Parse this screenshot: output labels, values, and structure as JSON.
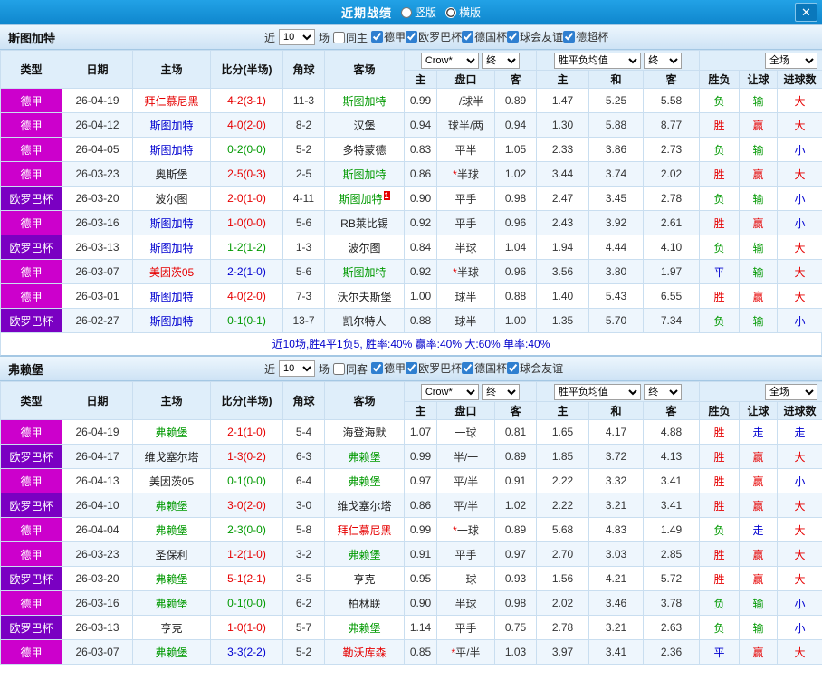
{
  "colors": {
    "titlebar_bg": "#1596DE",
    "accent_red": "#E60000",
    "accent_green": "#009900",
    "accent_blue": "#0000D0",
    "league_colors": {
      "德甲": "#CC00CC",
      "欧罗巴杯": "#7A00C2"
    }
  },
  "titlebar": {
    "title": "近期战绩",
    "layout_options": [
      {
        "label": "竖版",
        "selected": false
      },
      {
        "label": "横版",
        "selected": true
      }
    ],
    "close_label": "✕"
  },
  "table_header": {
    "type": "类型",
    "date": "日期",
    "home": "主场",
    "score": "比分(半场)",
    "corner": "角球",
    "away": "客场",
    "bookmaker_select": "Crow*",
    "final_select_1": "终",
    "avg_select": "胜平负均值",
    "final_select_2": "终",
    "scope_select": "全场",
    "sub_home": "主",
    "sub_line": "盘口",
    "sub_away": "客",
    "sub_home2": "主",
    "sub_draw": "和",
    "sub_away2": "客",
    "wdl": "胜负",
    "handicap_result": "让球",
    "goals": "进球数"
  },
  "sections": [
    {
      "team": "斯图加特",
      "near_label": "近",
      "match_count": "10",
      "games_label": "场",
      "venue_filter": {
        "label": "同主",
        "checked": false
      },
      "filters": [
        {
          "label": "德甲",
          "checked": true
        },
        {
          "label": "欧罗巴杯",
          "checked": true
        },
        {
          "label": "德国杯",
          "checked": true
        },
        {
          "label": "球会友谊",
          "checked": true
        },
        {
          "label": "德超杯",
          "checked": true
        }
      ],
      "rows": [
        {
          "league": "德甲",
          "date": "26-04-19",
          "home": "拜仁慕尼黑",
          "home_color": "red",
          "score": "4-2(3-1)",
          "score_color": "red",
          "corners": "11-3",
          "away": "斯图加特",
          "away_color": "green",
          "handicap_home": "0.99",
          "handicap": "一/球半",
          "handicap_away": "0.89",
          "avg_home": "1.47",
          "avg_draw": "5.25",
          "avg_away": "5.58",
          "wdl": "负",
          "wdl_color": "green",
          "let": "输",
          "let_color": "green",
          "goal": "大",
          "goal_color": "red"
        },
        {
          "league": "德甲",
          "date": "26-04-12",
          "home": "斯图加特",
          "home_color": "blue",
          "score": "4-0(2-0)",
          "score_color": "red",
          "corners": "8-2",
          "away": "汉堡",
          "away_color": "black",
          "handicap_home": "0.94",
          "handicap": "球半/两",
          "handicap_away": "0.94",
          "avg_home": "1.30",
          "avg_draw": "5.88",
          "avg_away": "8.77",
          "wdl": "胜",
          "wdl_color": "red",
          "let": "赢",
          "let_color": "red",
          "goal": "大",
          "goal_color": "red"
        },
        {
          "league": "德甲",
          "date": "26-04-05",
          "home": "斯图加特",
          "home_color": "blue",
          "score": "0-2(0-0)",
          "score_color": "green",
          "corners": "5-2",
          "away": "多特蒙德",
          "away_color": "black",
          "handicap_home": "0.83",
          "handicap": "平半",
          "handicap_away": "1.05",
          "avg_home": "2.33",
          "avg_draw": "3.86",
          "avg_away": "2.73",
          "wdl": "负",
          "wdl_color": "green",
          "let": "输",
          "let_color": "green",
          "goal": "小",
          "goal_color": "blue"
        },
        {
          "league": "德甲",
          "date": "26-03-23",
          "home": "奥斯堡",
          "home_color": "black",
          "score": "2-5(0-3)",
          "score_color": "red",
          "corners": "2-5",
          "away": "斯图加特",
          "away_color": "green",
          "handicap_home": "0.86",
          "handicap": "*半球",
          "handicap_away": "1.02",
          "avg_home": "3.44",
          "avg_draw": "3.74",
          "avg_away": "2.02",
          "wdl": "胜",
          "wdl_color": "red",
          "let": "赢",
          "let_color": "red",
          "goal": "大",
          "goal_color": "red"
        },
        {
          "league": "欧罗巴杯",
          "date": "26-03-20",
          "home": "波尔图",
          "home_color": "black",
          "score": "2-0(1-0)",
          "score_color": "red",
          "corners": "4-11",
          "away": "斯图加特",
          "away_color": "green",
          "away_sup": "1",
          "handicap_home": "0.90",
          "handicap": "平手",
          "handicap_away": "0.98",
          "avg_home": "2.47",
          "avg_draw": "3.45",
          "avg_away": "2.78",
          "wdl": "负",
          "wdl_color": "green",
          "let": "输",
          "let_color": "green",
          "goal": "小",
          "goal_color": "blue"
        },
        {
          "league": "德甲",
          "date": "26-03-16",
          "home": "斯图加特",
          "home_color": "blue",
          "score": "1-0(0-0)",
          "score_color": "red",
          "corners": "5-6",
          "away": "RB莱比锡",
          "away_color": "black",
          "handicap_home": "0.92",
          "handicap": "平手",
          "handicap_away": "0.96",
          "avg_home": "2.43",
          "avg_draw": "3.92",
          "avg_away": "2.61",
          "wdl": "胜",
          "wdl_color": "red",
          "let": "赢",
          "let_color": "red",
          "goal": "小",
          "goal_color": "blue"
        },
        {
          "league": "欧罗巴杯",
          "date": "26-03-13",
          "home": "斯图加特",
          "home_color": "blue",
          "score": "1-2(1-2)",
          "score_color": "green",
          "corners": "1-3",
          "away": "波尔图",
          "away_color": "black",
          "handicap_home": "0.84",
          "handicap": "半球",
          "handicap_away": "1.04",
          "avg_home": "1.94",
          "avg_draw": "4.44",
          "avg_away": "4.10",
          "wdl": "负",
          "wdl_color": "green",
          "let": "输",
          "let_color": "green",
          "goal": "大",
          "goal_color": "red"
        },
        {
          "league": "德甲",
          "date": "26-03-07",
          "home": "美因茨05",
          "home_color": "red",
          "score": "2-2(1-0)",
          "score_color": "blue",
          "corners": "5-6",
          "away": "斯图加特",
          "away_color": "green",
          "handicap_home": "0.92",
          "handicap": "*半球",
          "handicap_away": "0.96",
          "avg_home": "3.56",
          "avg_draw": "3.80",
          "avg_away": "1.97",
          "wdl": "平",
          "wdl_color": "blue",
          "let": "输",
          "let_color": "green",
          "goal": "大",
          "goal_color": "red"
        },
        {
          "league": "德甲",
          "date": "26-03-01",
          "home": "斯图加特",
          "home_color": "blue",
          "score": "4-0(2-0)",
          "score_color": "red",
          "corners": "7-3",
          "away": "沃尔夫斯堡",
          "away_color": "black",
          "handicap_home": "1.00",
          "handicap": "球半",
          "handicap_away": "0.88",
          "avg_home": "1.40",
          "avg_draw": "5.43",
          "avg_away": "6.55",
          "wdl": "胜",
          "wdl_color": "red",
          "let": "赢",
          "let_color": "red",
          "goal": "大",
          "goal_color": "red"
        },
        {
          "league": "欧罗巴杯",
          "date": "26-02-27",
          "home": "斯图加特",
          "home_color": "blue",
          "score": "0-1(0-1)",
          "score_color": "green",
          "corners": "13-7",
          "away": "凯尔特人",
          "away_color": "black",
          "handicap_home": "0.88",
          "handicap": "球半",
          "handicap_away": "1.00",
          "avg_home": "1.35",
          "avg_draw": "5.70",
          "avg_away": "7.34",
          "wdl": "负",
          "wdl_color": "green",
          "let": "输",
          "let_color": "green",
          "goal": "小",
          "goal_color": "blue"
        }
      ],
      "summary": "近10场,胜4平1负5, 胜率:40% 赢率:40% 大:60% 单率:40%"
    },
    {
      "team": "弗赖堡",
      "near_label": "近",
      "match_count": "10",
      "games_label": "场",
      "venue_filter": {
        "label": "同客",
        "checked": false
      },
      "filters": [
        {
          "label": "德甲",
          "checked": true
        },
        {
          "label": "欧罗巴杯",
          "checked": true
        },
        {
          "label": "德国杯",
          "checked": true
        },
        {
          "label": "球会友谊",
          "checked": true
        }
      ],
      "rows": [
        {
          "league": "德甲",
          "date": "26-04-19",
          "home": "弗赖堡",
          "home_color": "green",
          "score": "2-1(1-0)",
          "score_color": "red",
          "corners": "5-4",
          "away": "海登海默",
          "away_color": "black",
          "handicap_home": "1.07",
          "handicap": "一球",
          "handicap_away": "0.81",
          "avg_home": "1.65",
          "avg_draw": "4.17",
          "avg_away": "4.88",
          "wdl": "胜",
          "wdl_color": "red",
          "let": "走",
          "let_color": "blue",
          "goal": "走",
          "goal_color": "blue"
        },
        {
          "league": "欧罗巴杯",
          "date": "26-04-17",
          "home": "维戈塞尔塔",
          "home_color": "black",
          "score": "1-3(0-2)",
          "score_color": "red",
          "corners": "6-3",
          "away": "弗赖堡",
          "away_color": "green",
          "handicap_home": "0.99",
          "handicap": "半/一",
          "handicap_away": "0.89",
          "avg_home": "1.85",
          "avg_draw": "3.72",
          "avg_away": "4.13",
          "wdl": "胜",
          "wdl_color": "red",
          "let": "赢",
          "let_color": "red",
          "goal": "大",
          "goal_color": "red"
        },
        {
          "league": "德甲",
          "date": "26-04-13",
          "home": "美因茨05",
          "home_color": "black",
          "score": "0-1(0-0)",
          "score_color": "green",
          "corners": "6-4",
          "away": "弗赖堡",
          "away_color": "green",
          "handicap_home": "0.97",
          "handicap": "平/半",
          "handicap_away": "0.91",
          "avg_home": "2.22",
          "avg_draw": "3.32",
          "avg_away": "3.41",
          "wdl": "胜",
          "wdl_color": "red",
          "let": "赢",
          "let_color": "red",
          "goal": "小",
          "goal_color": "blue"
        },
        {
          "league": "欧罗巴杯",
          "date": "26-04-10",
          "home": "弗赖堡",
          "home_color": "green",
          "score": "3-0(2-0)",
          "score_color": "red",
          "corners": "3-0",
          "away": "维戈塞尔塔",
          "away_color": "black",
          "handicap_home": "0.86",
          "handicap": "平/半",
          "handicap_away": "1.02",
          "avg_home": "2.22",
          "avg_draw": "3.21",
          "avg_away": "3.41",
          "wdl": "胜",
          "wdl_color": "red",
          "let": "赢",
          "let_color": "red",
          "goal": "大",
          "goal_color": "red"
        },
        {
          "league": "德甲",
          "date": "26-04-04",
          "home": "弗赖堡",
          "home_color": "green",
          "score": "2-3(0-0)",
          "score_color": "green",
          "corners": "5-8",
          "away": "拜仁慕尼黑",
          "away_color": "red",
          "handicap_home": "0.99",
          "handicap": "*一球",
          "handicap_away": "0.89",
          "avg_home": "5.68",
          "avg_draw": "4.83",
          "avg_away": "1.49",
          "wdl": "负",
          "wdl_color": "green",
          "let": "走",
          "let_color": "blue",
          "goal": "大",
          "goal_color": "red"
        },
        {
          "league": "德甲",
          "date": "26-03-23",
          "home": "圣保利",
          "home_color": "black",
          "score": "1-2(1-0)",
          "score_color": "red",
          "corners": "3-2",
          "away": "弗赖堡",
          "away_color": "green",
          "handicap_home": "0.91",
          "handicap": "平手",
          "handicap_away": "0.97",
          "avg_home": "2.70",
          "avg_draw": "3.03",
          "avg_away": "2.85",
          "wdl": "胜",
          "wdl_color": "red",
          "let": "赢",
          "let_color": "red",
          "goal": "大",
          "goal_color": "red"
        },
        {
          "league": "欧罗巴杯",
          "date": "26-03-20",
          "home": "弗赖堡",
          "home_color": "green",
          "score": "5-1(2-1)",
          "score_color": "red",
          "corners": "3-5",
          "away": "亨克",
          "away_color": "black",
          "handicap_home": "0.95",
          "handicap": "一球",
          "handicap_away": "0.93",
          "avg_home": "1.56",
          "avg_draw": "4.21",
          "avg_away": "5.72",
          "wdl": "胜",
          "wdl_color": "red",
          "let": "赢",
          "let_color": "red",
          "goal": "大",
          "goal_color": "red"
        },
        {
          "league": "德甲",
          "date": "26-03-16",
          "home": "弗赖堡",
          "home_color": "green",
          "score": "0-1(0-0)",
          "score_color": "green",
          "corners": "6-2",
          "away": "柏林联",
          "away_color": "black",
          "handicap_home": "0.90",
          "handicap": "半球",
          "handicap_away": "0.98",
          "avg_home": "2.02",
          "avg_draw": "3.46",
          "avg_away": "3.78",
          "wdl": "负",
          "wdl_color": "green",
          "let": "输",
          "let_color": "green",
          "goal": "小",
          "goal_color": "blue"
        },
        {
          "league": "欧罗巴杯",
          "date": "26-03-13",
          "home": "亨克",
          "home_color": "black",
          "score": "1-0(1-0)",
          "score_color": "red",
          "corners": "5-7",
          "away": "弗赖堡",
          "away_color": "green",
          "handicap_home": "1.14",
          "handicap": "平手",
          "handicap_away": "0.75",
          "avg_home": "2.78",
          "avg_draw": "3.21",
          "avg_away": "2.63",
          "wdl": "负",
          "wdl_color": "green",
          "let": "输",
          "let_color": "green",
          "goal": "小",
          "goal_color": "blue"
        },
        {
          "league": "德甲",
          "date": "26-03-07",
          "home": "弗赖堡",
          "home_color": "green",
          "score": "3-3(2-2)",
          "score_color": "blue",
          "corners": "5-2",
          "away": "勒沃库森",
          "away_color": "red",
          "handicap_home": "0.85",
          "handicap": "*平/半",
          "handicap_away": "1.03",
          "avg_home": "3.97",
          "avg_draw": "3.41",
          "avg_away": "2.36",
          "wdl": "平",
          "wdl_color": "blue",
          "let": "赢",
          "let_color": "red",
          "goal": "大",
          "goal_color": "red"
        }
      ]
    }
  ]
}
